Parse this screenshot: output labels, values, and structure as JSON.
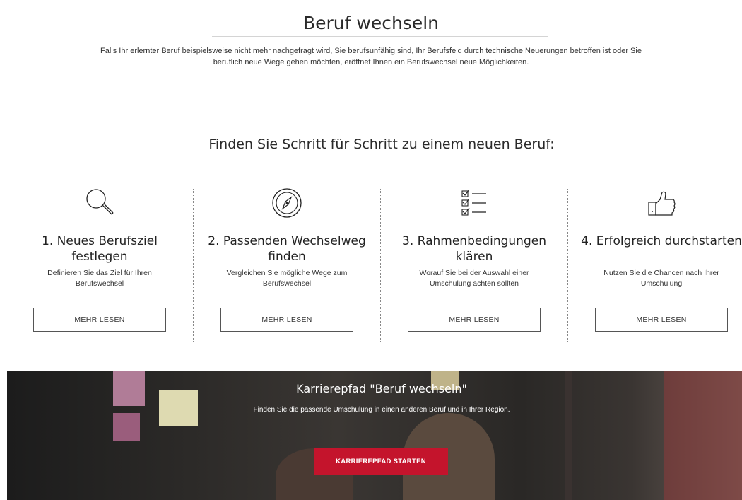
{
  "header": {
    "title": "Beruf wechseln",
    "intro": "Falls Ihr erlernter Beruf beispielsweise nicht mehr nachgefragt wird, Sie berufsunfähig sind, Ihr Berufsfeld durch technische Neuerungen betroffen ist oder Sie beruflich neue Wege gehen möchten, eröffnet Ihnen ein Berufswechsel neue Möglichkeiten."
  },
  "steps_section": {
    "heading": "Finden Sie Schritt für Schritt zu einem neuen Beruf:",
    "steps": [
      {
        "icon": "magnifier-icon",
        "title": "1. Neues Berufsziel festlegen",
        "description": "Definieren Sie das Ziel für Ihren Berufswechsel",
        "button": "MEHR LESEN"
      },
      {
        "icon": "compass-icon",
        "title": "2. Passenden Wechselweg finden",
        "description": "Vergleichen Sie mögliche Wege zum Berufswechsel",
        "button": "MEHR LESEN"
      },
      {
        "icon": "checklist-icon",
        "title": "3. Rahmenbedingungen klären",
        "description": "Worauf Sie bei der Auswahl einer Umschulung achten sollten",
        "button": "MEHR LESEN"
      },
      {
        "icon": "thumbs-up-icon",
        "title": "4. Erfolgreich durchstarten",
        "description": "Nutzen Sie die Chancen nach Ihrer Umschulung",
        "button": "MEHR LESEN"
      }
    ]
  },
  "banner": {
    "title": "Karrierepfad \"Beruf wechseln\"",
    "subtitle": "Finden Sie die passende Umschulung in einen anderen Beruf und in Ihrer Region.",
    "button": "KARRIEREPFAD STARTEN",
    "button_color": "#c4142c"
  }
}
